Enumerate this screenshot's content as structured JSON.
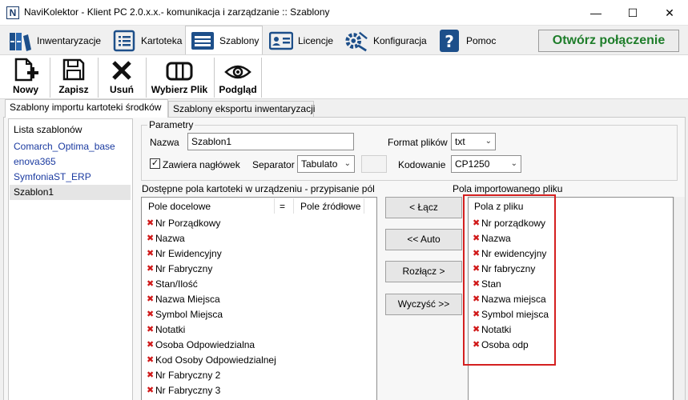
{
  "window": {
    "title": "NaviKolektor - Klient PC 2.0.x.x.- komunikacja i zarządzanie :: Szablony",
    "app_icon": "N",
    "controls": [
      "—",
      "☐",
      "✕"
    ]
  },
  "main_tabs": [
    {
      "label": "Inwentaryzacje",
      "icon": "binders-icon"
    },
    {
      "label": "Kartoteka",
      "icon": "list-icon"
    },
    {
      "label": "Szablony",
      "icon": "template-icon",
      "active": true
    },
    {
      "label": "Licencje",
      "icon": "id-card-icon"
    },
    {
      "label": "Konfiguracja",
      "icon": "gear-icon"
    },
    {
      "label": "Pomoc",
      "icon": "question-icon"
    }
  ],
  "connect_button": "Otwórz połączenie",
  "toolbar": {
    "new": "Nowy",
    "save": "Zapisz",
    "delete": "Usuń",
    "pick_file": "Wybierz Plik",
    "preview": "Podgląd"
  },
  "sub_tabs": [
    "Szablony importu kartoteki środków",
    "Szablony eksportu inwentaryzacji"
  ],
  "templates": {
    "header": "Lista szablonów",
    "items": [
      "Comarch_Optima_base",
      "enova365",
      "SymfoniaST_ERP",
      "Szablon1"
    ]
  },
  "params": {
    "legend": "Parametry",
    "name_label": "Nazwa",
    "name_value": "Szablon1",
    "format_label": "Format plików",
    "format_value": "txt",
    "headers_label": "Zawiera nagłówek",
    "headers_checked": "✓",
    "separator_label": "Separator",
    "separator_value": "Tabulato",
    "encoding_label": "Kodowanie",
    "encoding_value": "CP1250"
  },
  "available": {
    "title": "Dostępne pola kartoteki w urządzeniu - przypisanie pól",
    "col_dest": "Pole docelowe",
    "col_eq": "=",
    "col_src": "Pole źródłowe",
    "rows": [
      "Nr Porządkowy",
      "Nazwa",
      "Nr Ewidencyjny",
      "Nr Fabryczny",
      "Stan/Ilość",
      "Nazwa Miejsca",
      "Symbol Miejsca",
      "Notatki",
      "Osoba Odpowiedzialna",
      "Kod Osoby Odpowiedzialnej",
      "Nr Fabryczny 2",
      "Nr Fabryczny 3"
    ]
  },
  "buttons": {
    "connect": "< Łącz",
    "auto": "<< Auto",
    "disconnect": "Rozłącz >",
    "clear": "Wyczyść >>"
  },
  "imported": {
    "title": "Pola importowanego pliku",
    "header": "Pola z pliku",
    "rows": [
      "Nr porządkowy",
      "Nazwa",
      "Nr ewidencyjny",
      "Nr fabryczny",
      "Stan",
      "Nazwa miejsca",
      "Symbol miejsca",
      "Notatki",
      "Osoba odp"
    ]
  },
  "mark": "✖",
  "colors": {
    "connect_text": "#1e7d2a",
    "link": "#1a3aa0",
    "mark": "#d01818",
    "highlight": "#d42020"
  }
}
